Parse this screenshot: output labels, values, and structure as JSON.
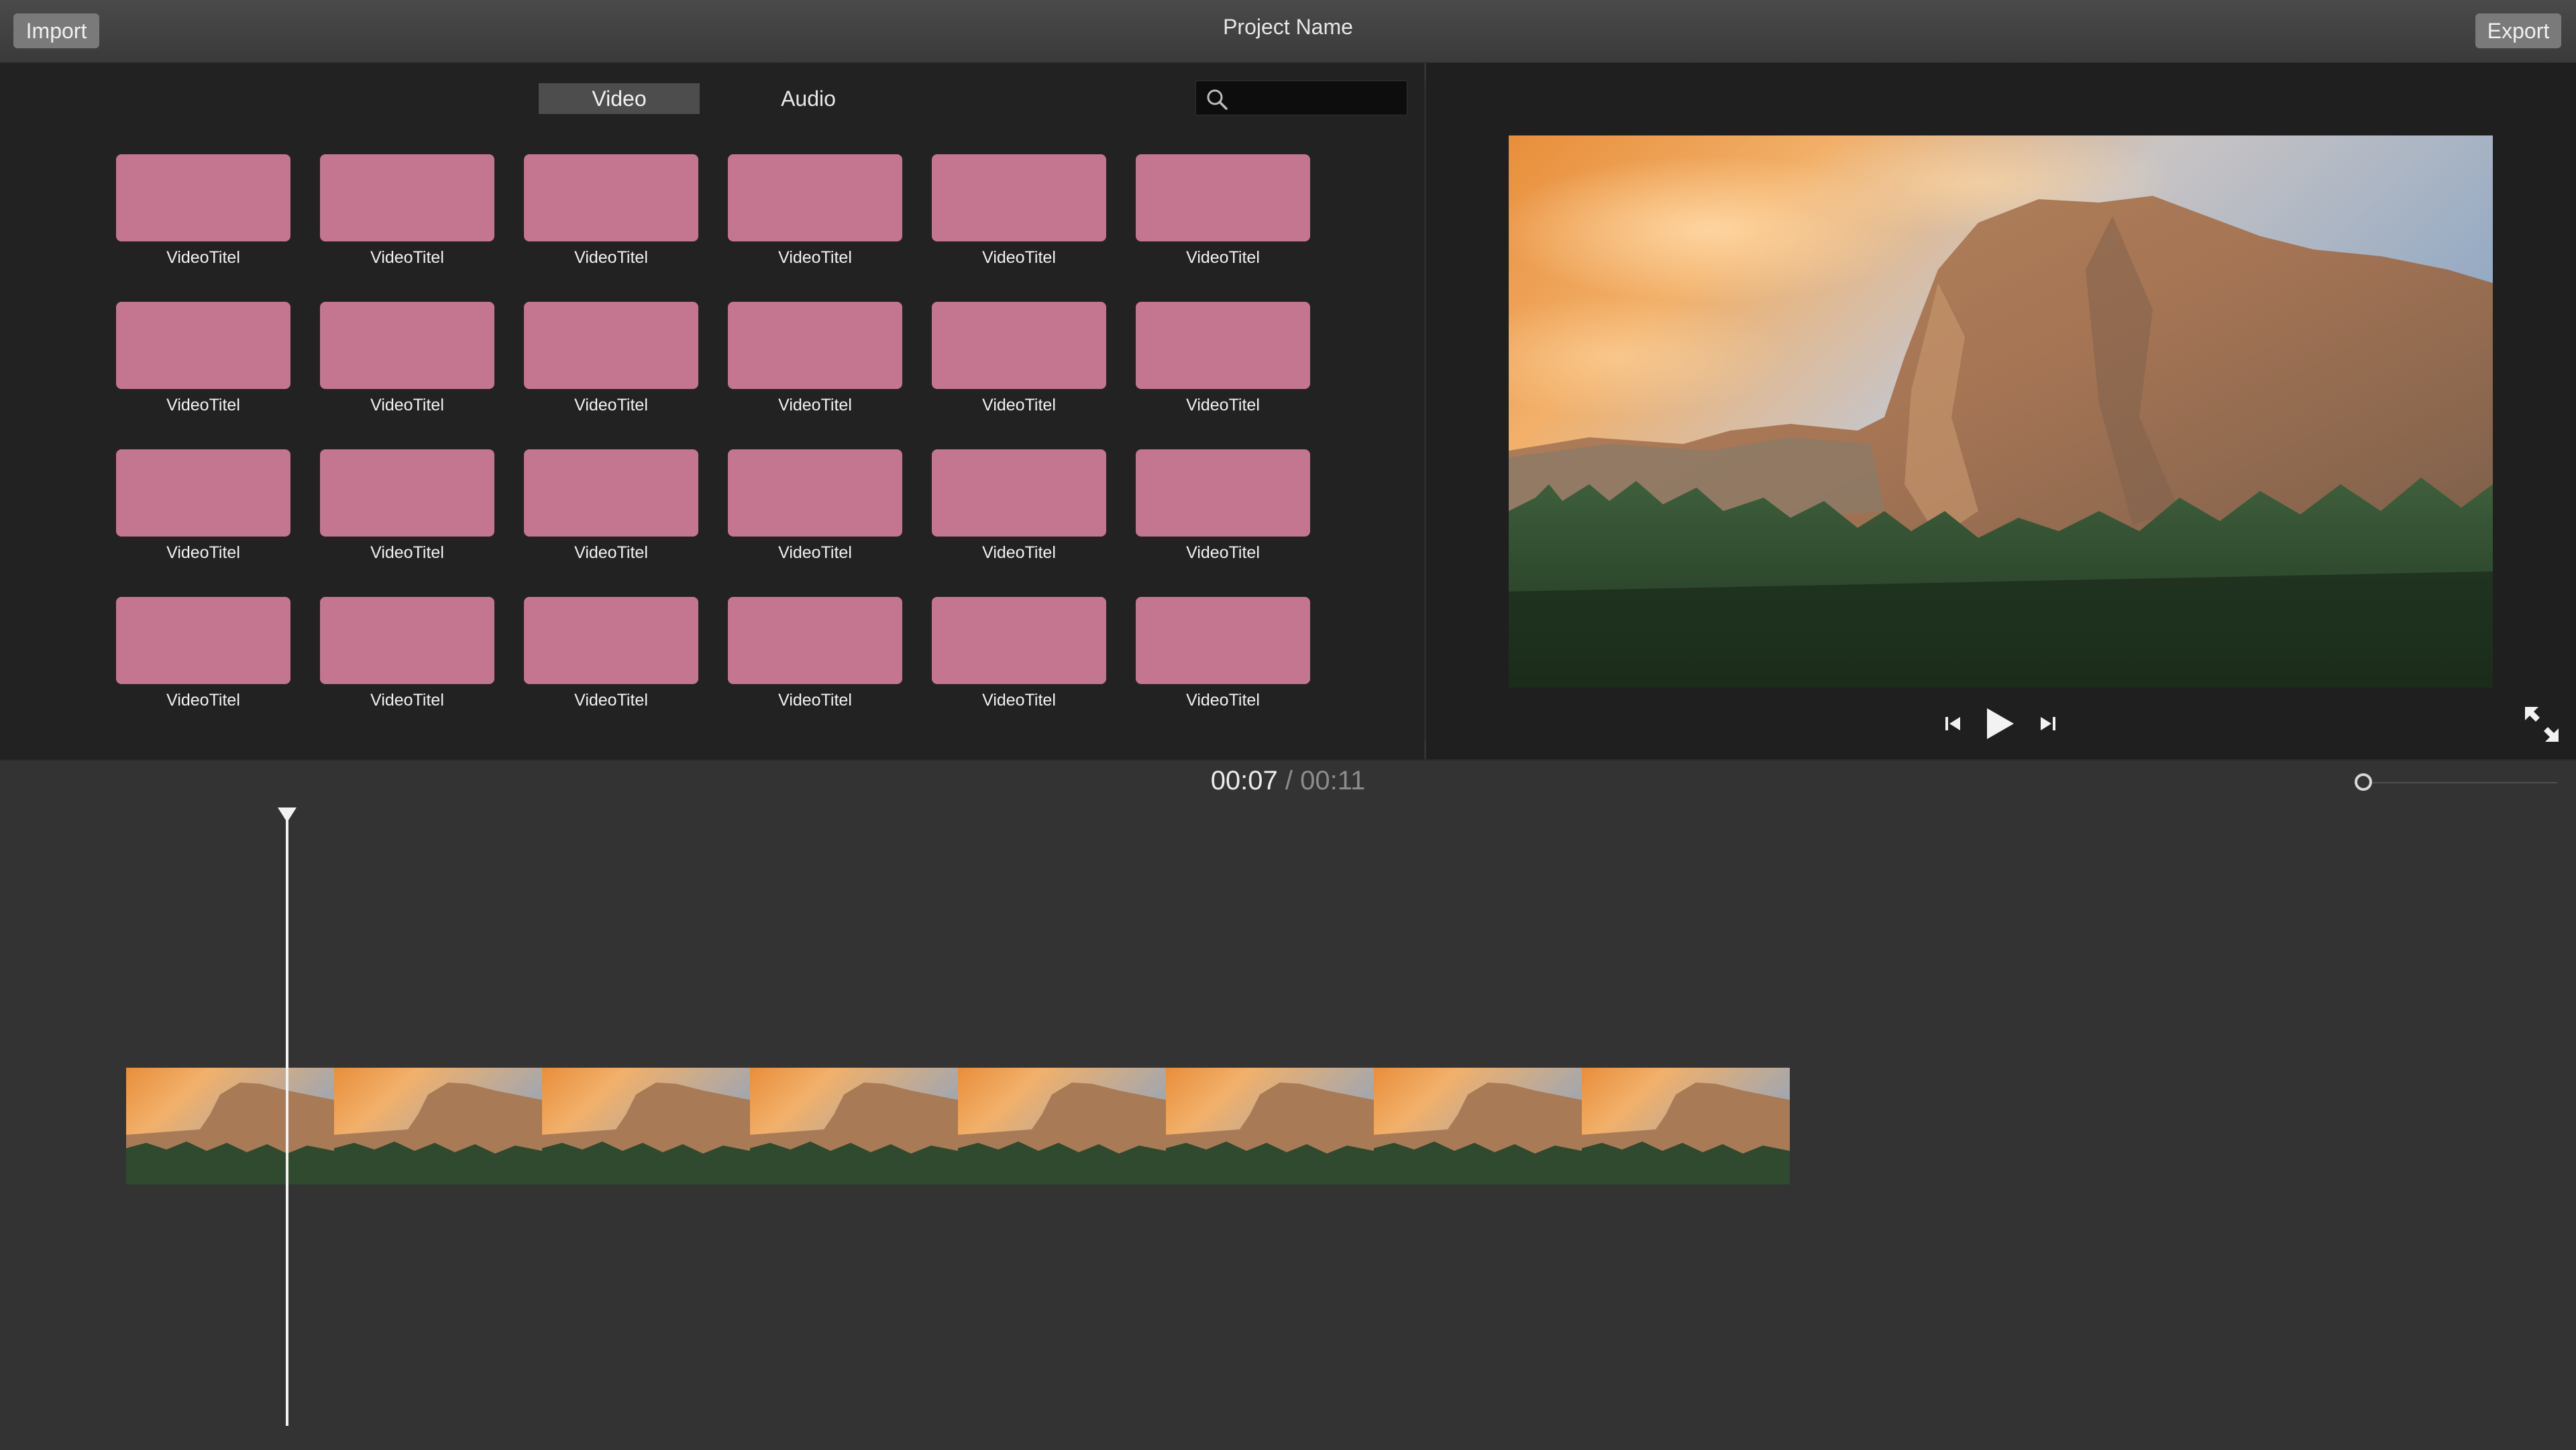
{
  "toolbar": {
    "import_label": "Import",
    "project_title": "Project Name",
    "export_label": "Export"
  },
  "library": {
    "tabs": [
      {
        "label": "Video",
        "active": true
      },
      {
        "label": "Audio",
        "active": false
      }
    ],
    "search": {
      "value": "",
      "placeholder": "",
      "icon": "magnifier"
    },
    "clips": [
      {
        "title": "VideoTitel"
      },
      {
        "title": "VideoTitel"
      },
      {
        "title": "VideoTitel"
      },
      {
        "title": "VideoTitel"
      },
      {
        "title": "VideoTitel"
      },
      {
        "title": "VideoTitel"
      },
      {
        "title": "VideoTitel"
      },
      {
        "title": "VideoTitel"
      },
      {
        "title": "VideoTitel"
      },
      {
        "title": "VideoTitel"
      },
      {
        "title": "VideoTitel"
      },
      {
        "title": "VideoTitel"
      },
      {
        "title": "VideoTitel"
      },
      {
        "title": "VideoTitel"
      },
      {
        "title": "VideoTitel"
      },
      {
        "title": "VideoTitel"
      },
      {
        "title": "VideoTitel"
      },
      {
        "title": "VideoTitel"
      },
      {
        "title": "VideoTitel"
      },
      {
        "title": "VideoTitel"
      },
      {
        "title": "VideoTitel"
      },
      {
        "title": "VideoTitel"
      },
      {
        "title": "VideoTitel"
      },
      {
        "title": "VideoTitel"
      }
    ],
    "clip_color": "#c47590"
  },
  "viewer": {
    "controls": {
      "skip_back_icon": "skip-back-icon",
      "play_icon": "play-icon",
      "skip_forward_icon": "skip-forward-icon",
      "fullscreen_icon": "expand-arrows-icon"
    }
  },
  "timeline": {
    "current_time": "00:07",
    "separator": "/",
    "total_time": "00:11",
    "zoom_level": 0.0,
    "playhead_fraction": 0.64,
    "filmstrip_frame_count": 8
  },
  "colors": {
    "topbar": "#404040",
    "library_bg": "#222222",
    "timeline_bg": "#333333",
    "button_bg": "#7a7a7a"
  }
}
